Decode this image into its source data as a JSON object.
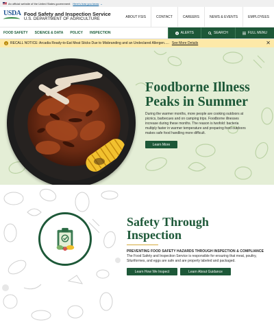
{
  "gov_banner": {
    "text": "An official website of the United States government",
    "link": "Here's how you know"
  },
  "header": {
    "logo_text": "USDA",
    "agency_name": "Food Safety and Inspection Service",
    "department": "U.S. DEPARTMENT OF AGRICULTURE",
    "links": [
      "ABOUT FSIS",
      "CONTACT",
      "CAREERS",
      "NEWS & EVENTS",
      "EMPLOYEES"
    ]
  },
  "nav": {
    "items": [
      "FOOD SAFETY",
      "SCIENCE & DATA",
      "POLICY",
      "INSPECTION"
    ],
    "alerts_label": "ALERTS",
    "search_label": "SEARCH",
    "menu_label": "FULL MENU"
  },
  "alert": {
    "message": "RECALL NOTICE: Arcadia Ready-to-Eat Meat Sticks Due to Misbranding and an Undeclared Allergen.....",
    "more_label": "See More Details",
    "color": "#fde9a8"
  },
  "hero": {
    "title": "Foodborne Illness Peaks in Summer",
    "body": "During the warmer months, more people are cooking outdoors at picnics, barbecues and on camping trips. Foodborne illnesses increase during these months. The reason is twofold: bacteria multiply faster in warmer temperature and preparing food outdoors makes safe food handling more difficult.",
    "button": "Learn More",
    "background": "#e4eed6"
  },
  "safety": {
    "title": "Safety Through Inspection",
    "subtitle": "PREVENTING FOOD SAFETY HAZARDS THROUGH INSPECTION & COMPLIANCE",
    "body": "The Food Safety and Inspection Service is responsible for ensuring that meat, poultry, Siluriformes, and eggs are safe and are properly labeled and packaged.",
    "button1": "Learn How We Inspect",
    "button2": "Learn About Guidance"
  },
  "colors": {
    "brand_green": "#1d5838",
    "accent_gold": "#d5a93a",
    "usda_blue": "#205493"
  }
}
